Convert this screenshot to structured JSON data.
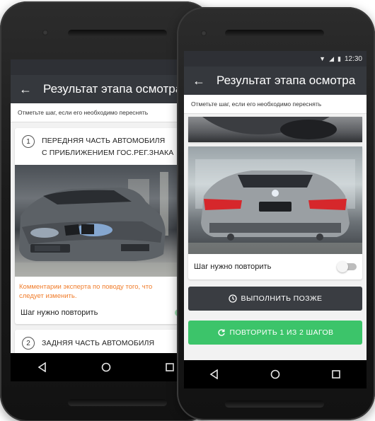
{
  "colors": {
    "appbar": "#35383d",
    "accent_green": "#3cc46a",
    "comment_orange": "#f07c2a",
    "dark_button": "#3a3d42"
  },
  "left_phone": {
    "status": {
      "wifi_icon": "wifi-icon",
      "signal_icon": "signal-icon",
      "battery_icon": "battery-icon"
    },
    "appbar": {
      "back_icon": "arrow-left-icon",
      "title": "Результат этапа осмотра"
    },
    "hint": "Отметьте шаг, если его необходимо переснять",
    "step1": {
      "number": "1",
      "title_line1": "ПЕРЕДНЯЯ ЧАСТЬ АВТОМОБИЛЯ",
      "title_line2": "С ПРИБЛИЖЕНИЕМ ГОС.РЕГ.ЗНАКА",
      "comment_line1": "Комментарии эксперта по поводу того, что",
      "comment_line2": "следует изменить.",
      "repeat_label": "Шаг нужно повторить",
      "repeat_on": true
    },
    "step2": {
      "number": "2",
      "title": "ЗАДНЯЯ ЧАСТЬ АВТОМОБИЛЯ"
    },
    "nav": {
      "back": "back-triangle-icon",
      "home": "home-circle-icon",
      "recents": "recents-square-icon"
    }
  },
  "right_phone": {
    "status": {
      "time": "12:30"
    },
    "appbar": {
      "back_icon": "arrow-left-icon",
      "title": "Результат этапа осмотра"
    },
    "hint": "Отметьте шаг, если его необходимо переснять",
    "repeat_label": "Шаг нужно повторить",
    "repeat_on": false,
    "later_button": {
      "icon": "clock-icon",
      "label": "ВЫПОЛНИТЬ ПОЗЖЕ"
    },
    "repeat_button": {
      "icon": "refresh-icon",
      "label": "ПОВТОРИТЬ 1 ИЗ 2 ШАГОВ"
    }
  }
}
